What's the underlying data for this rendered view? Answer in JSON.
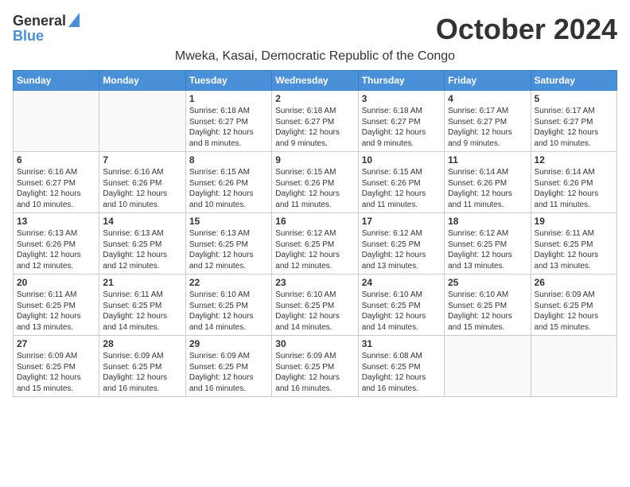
{
  "header": {
    "logo": {
      "general": "General",
      "blue": "Blue",
      "tagline": ""
    },
    "month": "October 2024",
    "location": "Mweka, Kasai, Democratic Republic of the Congo"
  },
  "weekdays": [
    "Sunday",
    "Monday",
    "Tuesday",
    "Wednesday",
    "Thursday",
    "Friday",
    "Saturday"
  ],
  "weeks": [
    [
      {
        "day": "",
        "sunrise": "",
        "sunset": "",
        "daylight": "",
        "empty": true
      },
      {
        "day": "",
        "sunrise": "",
        "sunset": "",
        "daylight": "",
        "empty": true
      },
      {
        "day": "1",
        "sunrise": "Sunrise: 6:18 AM",
        "sunset": "Sunset: 6:27 PM",
        "daylight": "Daylight: 12 hours and 8 minutes.",
        "empty": false
      },
      {
        "day": "2",
        "sunrise": "Sunrise: 6:18 AM",
        "sunset": "Sunset: 6:27 PM",
        "daylight": "Daylight: 12 hours and 9 minutes.",
        "empty": false
      },
      {
        "day": "3",
        "sunrise": "Sunrise: 6:18 AM",
        "sunset": "Sunset: 6:27 PM",
        "daylight": "Daylight: 12 hours and 9 minutes.",
        "empty": false
      },
      {
        "day": "4",
        "sunrise": "Sunrise: 6:17 AM",
        "sunset": "Sunset: 6:27 PM",
        "daylight": "Daylight: 12 hours and 9 minutes.",
        "empty": false
      },
      {
        "day": "5",
        "sunrise": "Sunrise: 6:17 AM",
        "sunset": "Sunset: 6:27 PM",
        "daylight": "Daylight: 12 hours and 10 minutes.",
        "empty": false
      }
    ],
    [
      {
        "day": "6",
        "sunrise": "Sunrise: 6:16 AM",
        "sunset": "Sunset: 6:27 PM",
        "daylight": "Daylight: 12 hours and 10 minutes.",
        "empty": false
      },
      {
        "day": "7",
        "sunrise": "Sunrise: 6:16 AM",
        "sunset": "Sunset: 6:26 PM",
        "daylight": "Daylight: 12 hours and 10 minutes.",
        "empty": false
      },
      {
        "day": "8",
        "sunrise": "Sunrise: 6:15 AM",
        "sunset": "Sunset: 6:26 PM",
        "daylight": "Daylight: 12 hours and 10 minutes.",
        "empty": false
      },
      {
        "day": "9",
        "sunrise": "Sunrise: 6:15 AM",
        "sunset": "Sunset: 6:26 PM",
        "daylight": "Daylight: 12 hours and 11 minutes.",
        "empty": false
      },
      {
        "day": "10",
        "sunrise": "Sunrise: 6:15 AM",
        "sunset": "Sunset: 6:26 PM",
        "daylight": "Daylight: 12 hours and 11 minutes.",
        "empty": false
      },
      {
        "day": "11",
        "sunrise": "Sunrise: 6:14 AM",
        "sunset": "Sunset: 6:26 PM",
        "daylight": "Daylight: 12 hours and 11 minutes.",
        "empty": false
      },
      {
        "day": "12",
        "sunrise": "Sunrise: 6:14 AM",
        "sunset": "Sunset: 6:26 PM",
        "daylight": "Daylight: 12 hours and 11 minutes.",
        "empty": false
      }
    ],
    [
      {
        "day": "13",
        "sunrise": "Sunrise: 6:13 AM",
        "sunset": "Sunset: 6:26 PM",
        "daylight": "Daylight: 12 hours and 12 minutes.",
        "empty": false
      },
      {
        "day": "14",
        "sunrise": "Sunrise: 6:13 AM",
        "sunset": "Sunset: 6:25 PM",
        "daylight": "Daylight: 12 hours and 12 minutes.",
        "empty": false
      },
      {
        "day": "15",
        "sunrise": "Sunrise: 6:13 AM",
        "sunset": "Sunset: 6:25 PM",
        "daylight": "Daylight: 12 hours and 12 minutes.",
        "empty": false
      },
      {
        "day": "16",
        "sunrise": "Sunrise: 6:12 AM",
        "sunset": "Sunset: 6:25 PM",
        "daylight": "Daylight: 12 hours and 12 minutes.",
        "empty": false
      },
      {
        "day": "17",
        "sunrise": "Sunrise: 6:12 AM",
        "sunset": "Sunset: 6:25 PM",
        "daylight": "Daylight: 12 hours and 13 minutes.",
        "empty": false
      },
      {
        "day": "18",
        "sunrise": "Sunrise: 6:12 AM",
        "sunset": "Sunset: 6:25 PM",
        "daylight": "Daylight: 12 hours and 13 minutes.",
        "empty": false
      },
      {
        "day": "19",
        "sunrise": "Sunrise: 6:11 AM",
        "sunset": "Sunset: 6:25 PM",
        "daylight": "Daylight: 12 hours and 13 minutes.",
        "empty": false
      }
    ],
    [
      {
        "day": "20",
        "sunrise": "Sunrise: 6:11 AM",
        "sunset": "Sunset: 6:25 PM",
        "daylight": "Daylight: 12 hours and 13 minutes.",
        "empty": false
      },
      {
        "day": "21",
        "sunrise": "Sunrise: 6:11 AM",
        "sunset": "Sunset: 6:25 PM",
        "daylight": "Daylight: 12 hours and 14 minutes.",
        "empty": false
      },
      {
        "day": "22",
        "sunrise": "Sunrise: 6:10 AM",
        "sunset": "Sunset: 6:25 PM",
        "daylight": "Daylight: 12 hours and 14 minutes.",
        "empty": false
      },
      {
        "day": "23",
        "sunrise": "Sunrise: 6:10 AM",
        "sunset": "Sunset: 6:25 PM",
        "daylight": "Daylight: 12 hours and 14 minutes.",
        "empty": false
      },
      {
        "day": "24",
        "sunrise": "Sunrise: 6:10 AM",
        "sunset": "Sunset: 6:25 PM",
        "daylight": "Daylight: 12 hours and 14 minutes.",
        "empty": false
      },
      {
        "day": "25",
        "sunrise": "Sunrise: 6:10 AM",
        "sunset": "Sunset: 6:25 PM",
        "daylight": "Daylight: 12 hours and 15 minutes.",
        "empty": false
      },
      {
        "day": "26",
        "sunrise": "Sunrise: 6:09 AM",
        "sunset": "Sunset: 6:25 PM",
        "daylight": "Daylight: 12 hours and 15 minutes.",
        "empty": false
      }
    ],
    [
      {
        "day": "27",
        "sunrise": "Sunrise: 6:09 AM",
        "sunset": "Sunset: 6:25 PM",
        "daylight": "Daylight: 12 hours and 15 minutes.",
        "empty": false
      },
      {
        "day": "28",
        "sunrise": "Sunrise: 6:09 AM",
        "sunset": "Sunset: 6:25 PM",
        "daylight": "Daylight: 12 hours and 16 minutes.",
        "empty": false
      },
      {
        "day": "29",
        "sunrise": "Sunrise: 6:09 AM",
        "sunset": "Sunset: 6:25 PM",
        "daylight": "Daylight: 12 hours and 16 minutes.",
        "empty": false
      },
      {
        "day": "30",
        "sunrise": "Sunrise: 6:09 AM",
        "sunset": "Sunset: 6:25 PM",
        "daylight": "Daylight: 12 hours and 16 minutes.",
        "empty": false
      },
      {
        "day": "31",
        "sunrise": "Sunrise: 6:08 AM",
        "sunset": "Sunset: 6:25 PM",
        "daylight": "Daylight: 12 hours and 16 minutes.",
        "empty": false
      },
      {
        "day": "",
        "sunrise": "",
        "sunset": "",
        "daylight": "",
        "empty": true
      },
      {
        "day": "",
        "sunrise": "",
        "sunset": "",
        "daylight": "",
        "empty": true
      }
    ]
  ]
}
